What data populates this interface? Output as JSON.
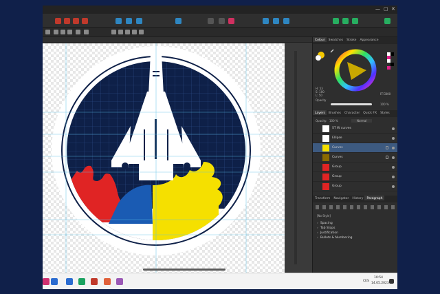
{
  "colors": {
    "navy": "#0e2048",
    "red": "#e02424",
    "yellow": "#f5e000",
    "blue": "#1a5bb3",
    "selection": "#3d5a80",
    "guide": "#5bc0e8"
  },
  "panel": {
    "top_tabs": [
      "Colour",
      "Swatches",
      "Stroke",
      "Appearance"
    ],
    "hex_value": "FFCB00",
    "opacity_label": "Opacity",
    "opacity_value": "100 %",
    "h_value": "H: 53",
    "s_value": "S: 100",
    "l_value": "L: 50",
    "layer_tabs": [
      "Layers",
      "Brushes",
      "Character",
      "Quick FX",
      "Styles"
    ],
    "layer_opacity_label": "Opacity:",
    "layer_opacity_value": "100 %",
    "blend_mode": "Normal",
    "layers": [
      {
        "name": "ST W curves",
        "selected": false,
        "thumb": "#ffffff"
      },
      {
        "name": "Ellipse",
        "selected": false,
        "thumb": "#ffffff"
      },
      {
        "name": "Curves",
        "selected": true,
        "thumb": "#f5e000"
      },
      {
        "name": "Curves",
        "selected": false,
        "thumb": "#8a6a00"
      },
      {
        "name": "Group",
        "selected": false,
        "thumb": "#e02424"
      },
      {
        "name": "Group",
        "selected": false,
        "thumb": "#e02424"
      },
      {
        "name": "Group",
        "selected": false,
        "thumb": "#e02424"
      }
    ],
    "bottom_tabs": [
      "Transform",
      "Navigator",
      "History",
      "Paragraph"
    ],
    "para_style": "[No Style]",
    "para_sections": [
      "Spacing",
      "Tab Stops",
      "Justification",
      "Bullets & Numbering"
    ]
  },
  "taskbar": {
    "lang": "CES",
    "time": "10:54",
    "date": "14.05.2023"
  }
}
